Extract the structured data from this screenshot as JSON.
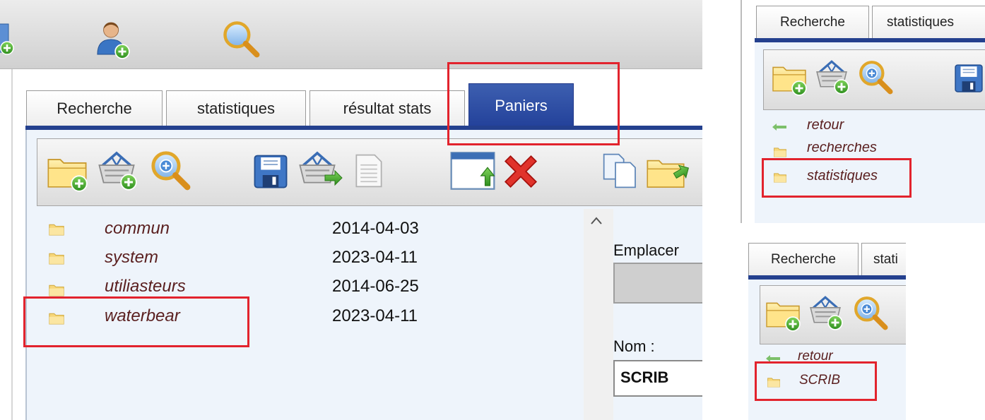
{
  "main": {
    "tabs": [
      {
        "label": "Recherche"
      },
      {
        "label": "statistiques"
      },
      {
        "label": "résultat stats"
      },
      {
        "label": "Paniers",
        "active": true
      }
    ],
    "rows": [
      {
        "name": "commun",
        "date": "2014-04-03"
      },
      {
        "name": "system",
        "date": "2023-04-11"
      },
      {
        "name": "utiliasteurs",
        "date": "2014-06-25"
      },
      {
        "name": "waterbear",
        "date": "2023-04-11"
      }
    ],
    "side": {
      "location_label": "Emplacer",
      "name_label": "Nom :",
      "name_value": "SCRIB"
    }
  },
  "panel_top_right": {
    "tabs": [
      {
        "label": "Recherche"
      },
      {
        "label": "statistiques"
      }
    ],
    "items": [
      {
        "label": "retour"
      },
      {
        "label": "recherches"
      },
      {
        "label": "statistiques"
      }
    ]
  },
  "panel_bottom_right": {
    "tabs": [
      {
        "label": "Recherche"
      },
      {
        "label": "stati"
      }
    ],
    "items": [
      {
        "label": "retour"
      },
      {
        "label": "SCRIB"
      }
    ]
  },
  "colors": {
    "accent": "#24408e",
    "highlight": "#e2232d",
    "item_text": "#5a1f1f"
  }
}
